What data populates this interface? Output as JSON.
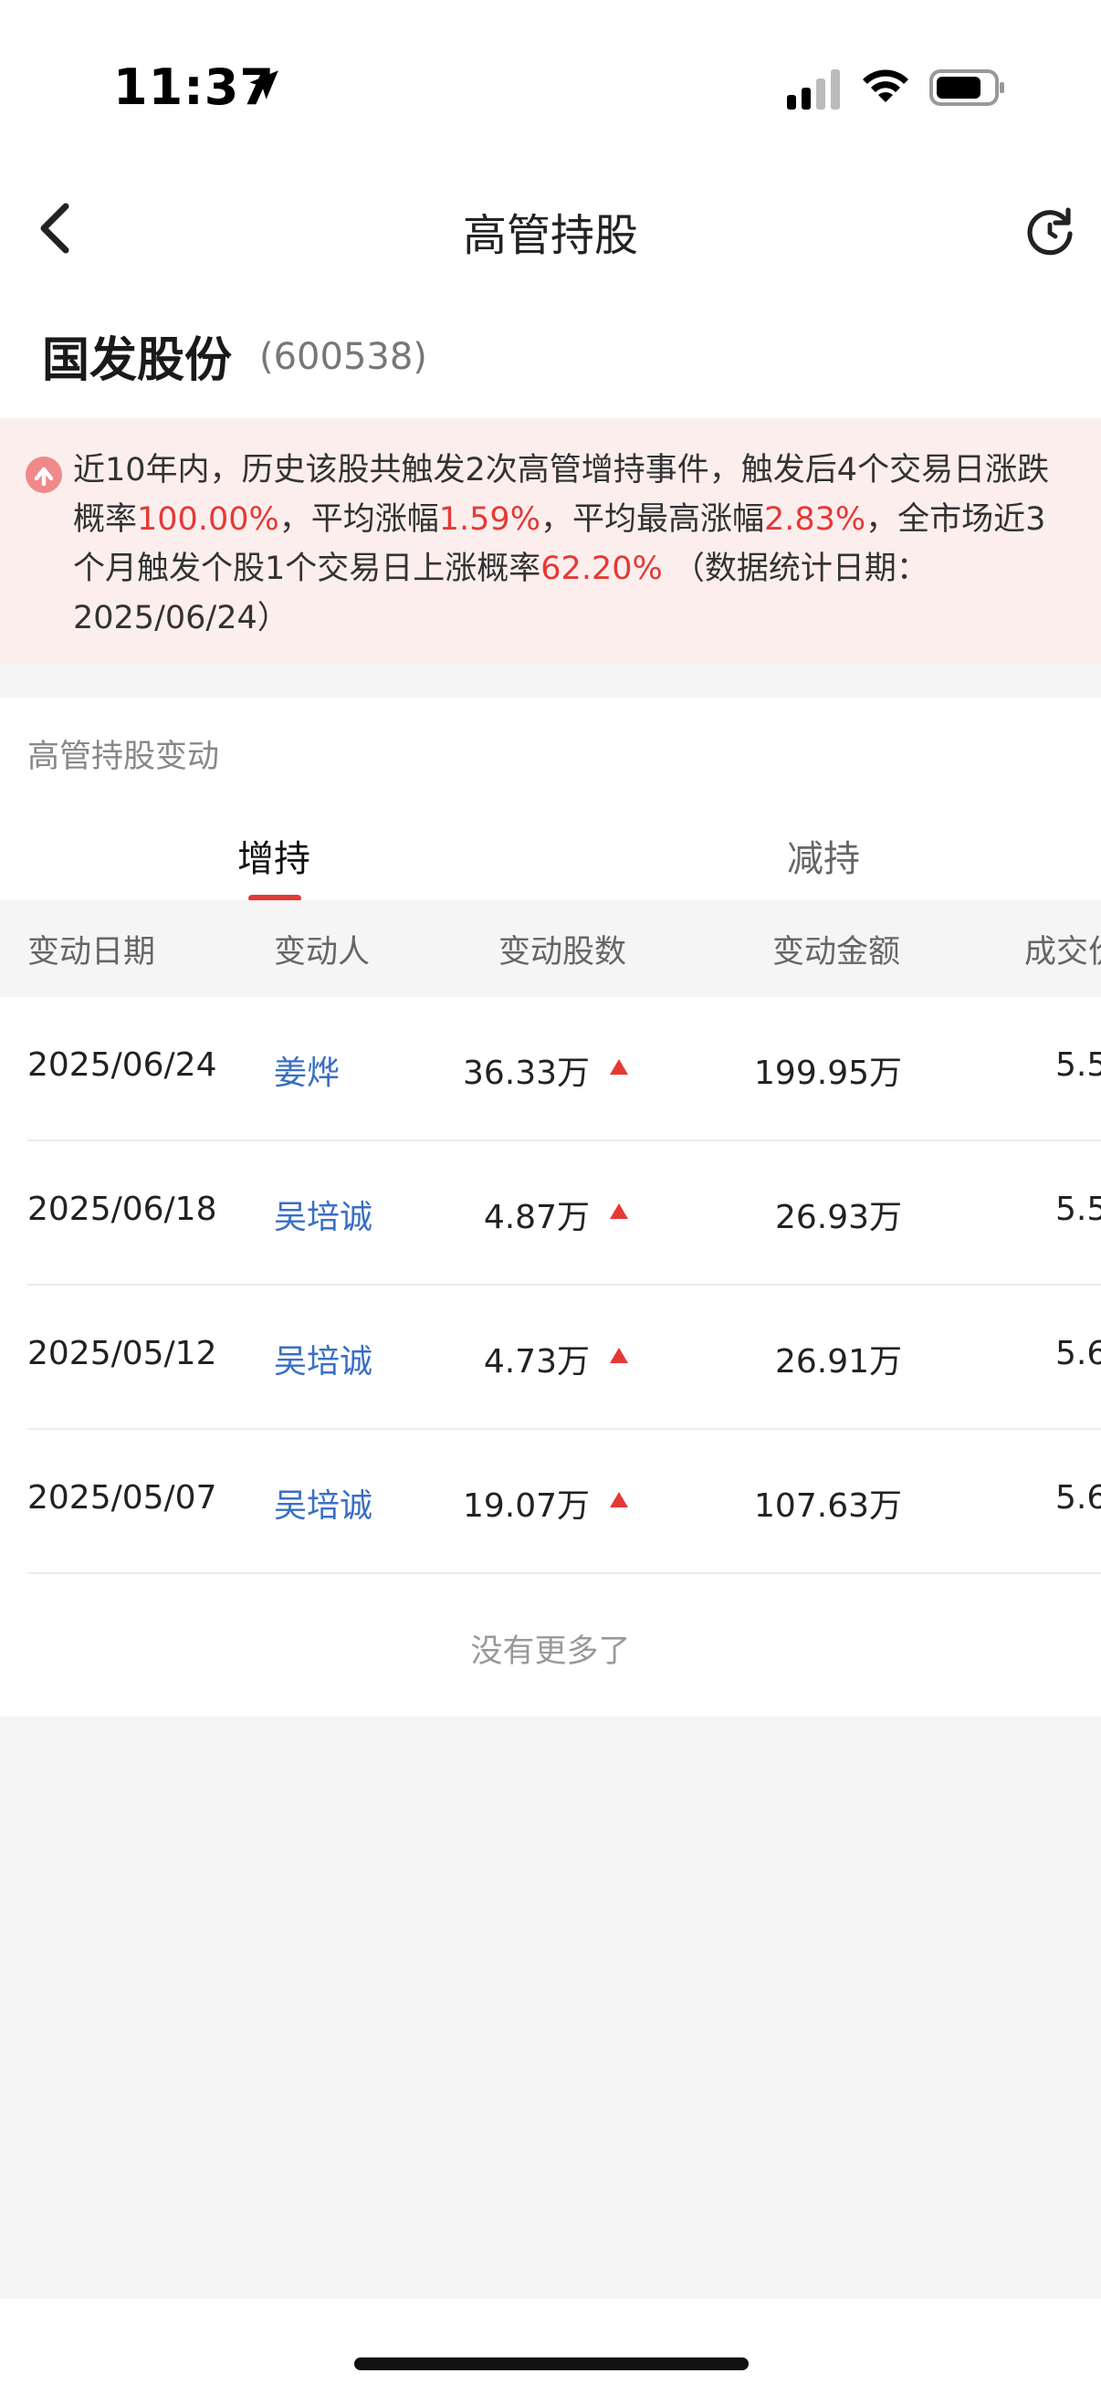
{
  "status_bar": {
    "time": "11:37"
  },
  "nav": {
    "title": "高管持股"
  },
  "stock": {
    "name": "国发股份",
    "code": "(600538)"
  },
  "banner": {
    "text_1": "近10年内，历史该股共触发2次高管增持事件，触发后4个交易日涨跌概率",
    "rate_up": "100.00%",
    "text_2": "，平均涨幅",
    "avg_rise": "1.59%",
    "text_3": "，平均最高涨幅",
    "avg_max_rise": "2.83%",
    "text_4": "，全市场近3个月触发个股1个交易日上涨概率",
    "market_rate": "62.20%",
    "text_5": " （数据统计日期：2025/06/24）"
  },
  "section": {
    "title": "高管持股变动",
    "tabs": [
      {
        "label": "增持",
        "active": true
      },
      {
        "label": "减持",
        "active": false
      }
    ],
    "columns": [
      "变动日期",
      "变动人",
      "变动股数",
      "变动金额",
      "成交价"
    ],
    "rows": [
      {
        "date": "2025/06/24",
        "person": "姜烨",
        "shares": "36.33万",
        "direction": "up",
        "amount": "199.95万",
        "price": "5.5"
      },
      {
        "date": "2025/06/18",
        "person": "吴培诚",
        "shares": "4.87万",
        "direction": "up",
        "amount": "26.93万",
        "price": "5.5"
      },
      {
        "date": "2025/05/12",
        "person": "吴培诚",
        "shares": "4.73万",
        "direction": "up",
        "amount": "26.91万",
        "price": "5.6"
      },
      {
        "date": "2025/05/07",
        "person": "吴培诚",
        "shares": "19.07万",
        "direction": "up",
        "amount": "107.63万",
        "price": "5.6"
      }
    ],
    "footer": "没有更多了"
  },
  "colors": {
    "accent_red": "#e53935",
    "link_blue": "#3a6fc4",
    "banner_bg": "#fdeeee"
  },
  "icons": [
    "location-arrow-icon",
    "cellular-signal-icon",
    "wifi-icon",
    "battery-icon",
    "back-chevron-icon",
    "refresh-icon",
    "rise-badge-icon",
    "up-triangle-icon"
  ]
}
